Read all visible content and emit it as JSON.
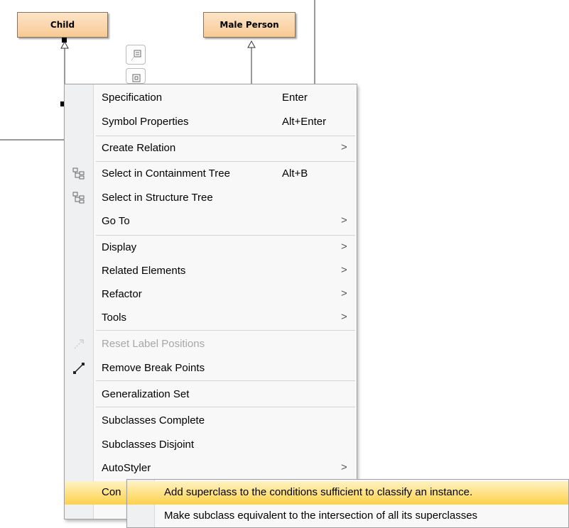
{
  "diagram": {
    "classes": [
      {
        "id": "child",
        "name": "Child"
      },
      {
        "id": "male",
        "name": "Male Person"
      }
    ]
  },
  "context_menu": {
    "items": [
      {
        "label": "Specification",
        "shortcut": "Enter"
      },
      {
        "label": "Symbol Properties",
        "shortcut": "Alt+Enter"
      },
      {
        "label": "Create Relation",
        "submenu": true
      },
      {
        "label": "Select in Containment Tree",
        "shortcut": "Alt+B",
        "icon": "containment-tree-icon"
      },
      {
        "label": "Select in Structure Tree",
        "icon": "structure-tree-icon"
      },
      {
        "label": "Go To",
        "submenu": true
      },
      {
        "label": "Display",
        "submenu": true
      },
      {
        "label": "Related Elements",
        "submenu": true
      },
      {
        "label": "Refactor",
        "submenu": true
      },
      {
        "label": "Tools",
        "submenu": true
      },
      {
        "label": "Reset Label Positions",
        "disabled": true,
        "icon": "reset-label-icon"
      },
      {
        "label": "Remove Break Points",
        "icon": "remove-break-points-icon"
      },
      {
        "label": "Generalization Set"
      },
      {
        "label": "Subclasses Complete"
      },
      {
        "label": "Subclasses Disjoint"
      },
      {
        "label": "AutoStyler",
        "submenu": true
      },
      {
        "label": "Con",
        "submenu": true,
        "highlighted": true
      }
    ],
    "submenu_arrow": ">"
  },
  "submenu": {
    "items": [
      {
        "label": "Add superclass to the conditions sufficient to classify an instance.",
        "highlighted": true
      },
      {
        "label": "Make subclass equivalent to the intersection of all its superclasses"
      }
    ]
  },
  "colors": {
    "class_fill_top": "#fde5c8",
    "class_fill_bottom": "#f8c994",
    "highlight_top": "#fff3c4",
    "highlight_bottom": "#ffd24a"
  }
}
